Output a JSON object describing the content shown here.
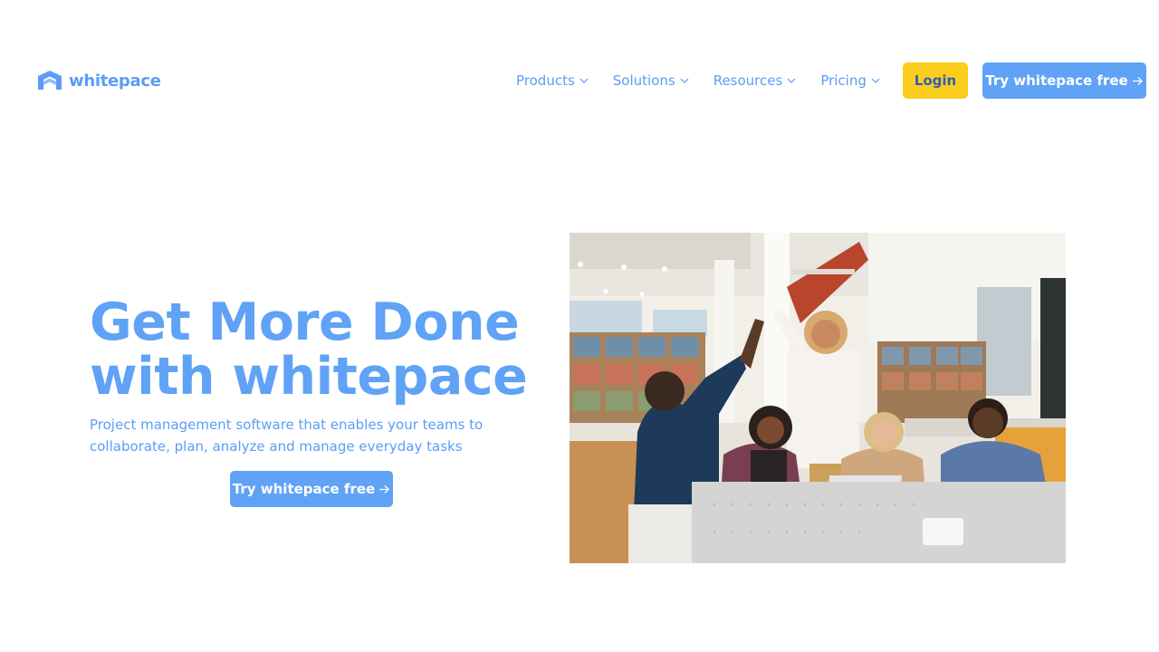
{
  "brand": {
    "name": "whitepace",
    "logo_icon": "chevron-up-logo-icon",
    "color": "#5b9df5"
  },
  "nav": {
    "items": [
      {
        "label": "Products"
      },
      {
        "label": "Solutions"
      },
      {
        "label": "Resources"
      },
      {
        "label": "Pricing"
      }
    ],
    "login_label": "Login",
    "cta_label": "Try whitepace free"
  },
  "hero": {
    "title_line1": "Get More Done",
    "title_line2": "with whitepace",
    "subtitle_line1": "Project management software that enables your teams to",
    "subtitle_line2": "collaborate, plan, analyze and manage everyday tasks",
    "cta_label": "Try whitepace free",
    "image_alt": "team-high-five-photo"
  },
  "colors": {
    "accent": "#5fa2f6",
    "login_bg": "#fbcd1c",
    "login_text": "#2f5eb6"
  }
}
